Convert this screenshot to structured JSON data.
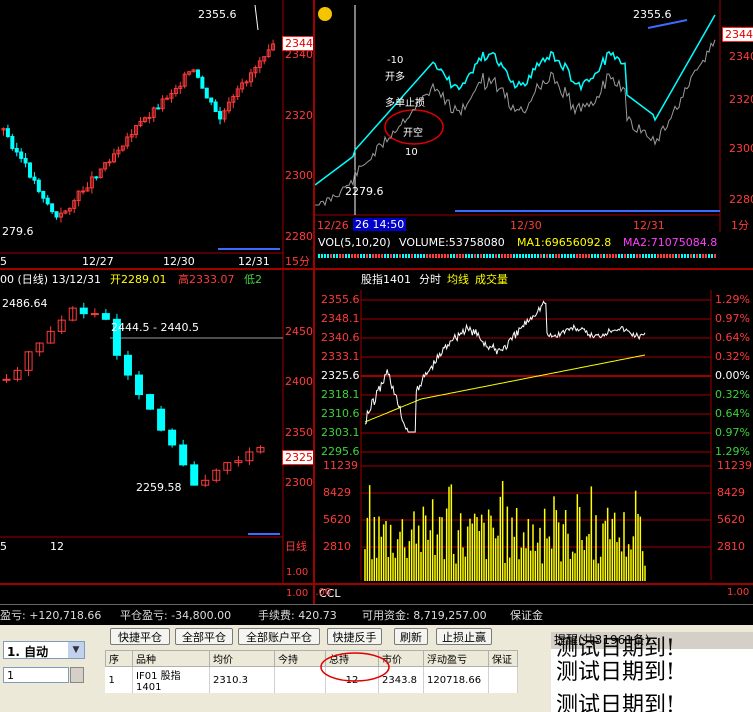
{
  "panel_tl": {
    "high_label": "2355.6",
    "low_label": "279.6",
    "price_box": "2344",
    "axis": [
      "2340",
      "2320",
      "2300",
      "2280"
    ],
    "dates": [
      "12/27",
      "12/30",
      "12/31"
    ],
    "period": "15分",
    "left_edge": "5"
  },
  "panel_tr": {
    "high_label": "2355.6",
    "low_label": "2279.6",
    "price_box": "2344",
    "axis": [
      "2340",
      "2320",
      "2300",
      "2280"
    ],
    "annotations": [
      "-10",
      "开多",
      "多单止损",
      "开空",
      "10"
    ],
    "dates": [
      "12/26",
      "26 14:50",
      "12/30",
      "12/31"
    ],
    "period": "1分",
    "icon": "smiley-icon"
  },
  "vol_bar": {
    "vol_label": "VOL(5,10,20)",
    "volume": "VOLUME:53758080",
    "ma1": "MA1:69656092.8",
    "ma2": "MA2:71075084.8"
  },
  "panel_daily": {
    "header_prefix": "00 (日线) 13/12/31",
    "open": "开2289.01",
    "high": "高2333.07",
    "low": "低2",
    "hi_label": "2486.64",
    "range_label": "2444.5 - 2440.5",
    "low_label": "2259.58",
    "price_box": "2325",
    "axis": [
      "2450",
      "2400",
      "2350",
      "2300"
    ],
    "bottom_left": "5",
    "bottom_mid": "12",
    "period": "日线"
  },
  "panel_intraday": {
    "title": "股指1401",
    "mode": "分时",
    "ma_label": "均线",
    "vol_label": "成交量",
    "left_axis": [
      "2355.6",
      "2348.1",
      "2340.6",
      "2333.1",
      "2325.6",
      "2318.1",
      "2310.6",
      "2303.1",
      "2295.6"
    ],
    "right_axis": [
      "1.29%",
      "0.97%",
      "0.64%",
      "0.32%",
      "0.00%",
      "0.32%",
      "0.64%",
      "0.97%",
      "1.29%"
    ],
    "vol_axis": [
      "11239",
      "8429",
      "5620",
      "2810"
    ],
    "vol_axis_right": [
      "11239",
      "8429",
      "5620",
      "2810"
    ]
  },
  "ccl_panel": {
    "label": "CCL",
    "left_axis": [
      "1.00",
      "1.00"
    ],
    "right_axis": [
      "1.00",
      "1.00"
    ]
  },
  "bottom_axes": {
    "left": [
      "1.00",
      "1.00"
    ],
    "right": [
      "1.00",
      "1.00"
    ]
  },
  "status": {
    "float_pl": "盈亏: +120,718.66",
    "close_pl": "平仓盈亏: -34,800.00",
    "fee": "手续费: 420.73",
    "available": "可用资金: 8,719,257.00",
    "margin": "保证金"
  },
  "trade": {
    "mode_select": "1. 自动",
    "qty_value": "1",
    "buttons": [
      "快捷平仓",
      "全部平仓",
      "全部账户平仓",
      "快捷反手",
      "刷新",
      "止损止赢"
    ],
    "columns": [
      "序",
      "品种",
      "均价",
      "今持",
      "总持",
      "市价",
      "浮动盈亏",
      "保证"
    ],
    "rows": [
      [
        "1",
        "IF01  股指1401",
        "2310.3",
        "",
        "12",
        "2343.8",
        "120718.66",
        ""
      ]
    ]
  },
  "alert": {
    "title": "提醒(共31961条)",
    "messages": [
      "测试日期到!",
      "测试日期到!",
      "测试日期到!"
    ]
  },
  "colors": {
    "up": "#ff3b3b",
    "down": "#00ffff",
    "grid": "#a00000",
    "price_line": "#ffffff",
    "avg_line": "#ffff00",
    "volume": "#ffff00"
  }
}
